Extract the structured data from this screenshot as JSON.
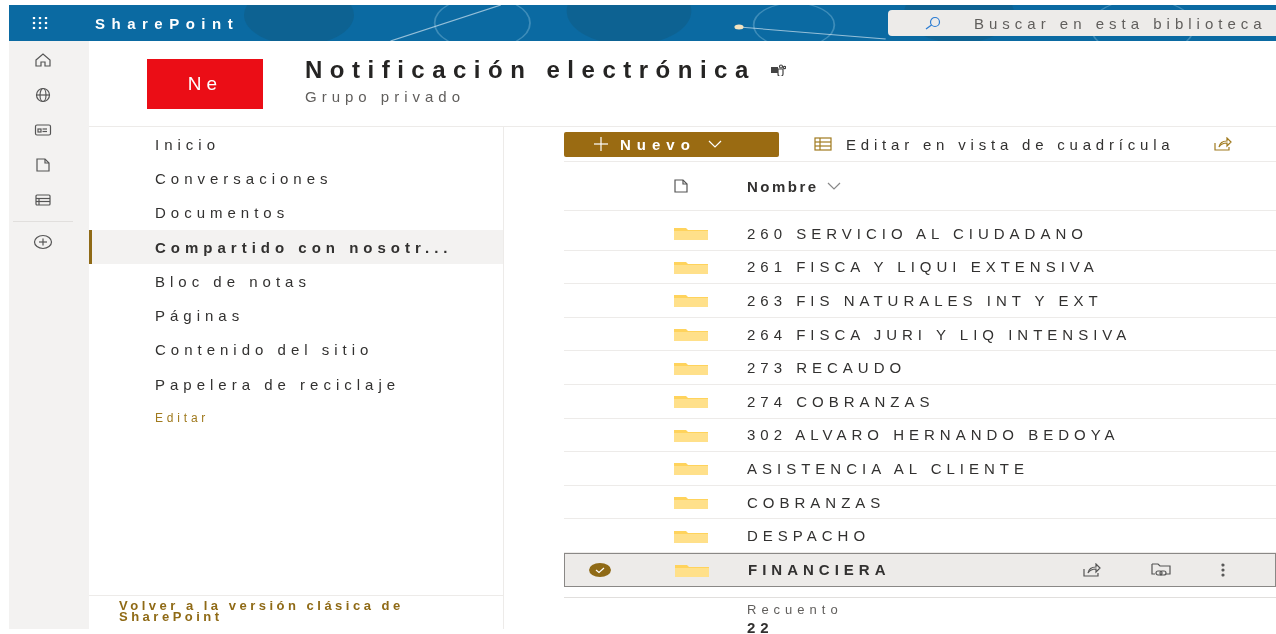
{
  "top_bar": {
    "app_name": "SharePoint",
    "search": {
      "placeholder": "Buscar en esta biblioteca"
    }
  },
  "site": {
    "logo_text": "Ne",
    "title": "Notificación electrónica",
    "subtitle": "Grupo privado"
  },
  "nav": {
    "items": [
      {
        "label": "Inicio",
        "selected": false
      },
      {
        "label": "Conversaciones",
        "selected": false
      },
      {
        "label": "Documentos",
        "selected": false
      },
      {
        "label": "Compartido con nosotr...",
        "selected": true
      },
      {
        "label": "Bloc de notas",
        "selected": false
      },
      {
        "label": "Páginas",
        "selected": false
      },
      {
        "label": "Contenido del sitio",
        "selected": false
      },
      {
        "label": "Papelera de reciclaje",
        "selected": false
      }
    ],
    "edit_link": "Editar",
    "classic_link": "Volver a la versión clásica de SharePoint"
  },
  "toolbar": {
    "new_button": "Nuevo",
    "grid_button": "Editar en vista de cuadrícula"
  },
  "table": {
    "columns": [
      "Nombre"
    ],
    "rows": [
      {
        "name": "260 SERVICIO AL CIUDADANO",
        "selected": false
      },
      {
        "name": "261 FISCA Y LIQUI EXTENSIVA",
        "selected": false
      },
      {
        "name": "263 FIS NATURALES INT Y EXT",
        "selected": false
      },
      {
        "name": "264 FISCA JURI Y LIQ INTENSIVA",
        "selected": false
      },
      {
        "name": "273 RECAUDO",
        "selected": false
      },
      {
        "name": "274 COBRANZAS",
        "selected": false
      },
      {
        "name": "302 ALVARO HERNANDO BEDOYA",
        "selected": false
      },
      {
        "name": "ASISTENCIA AL CLIENTE",
        "selected": false
      },
      {
        "name": "COBRANZAS",
        "selected": false
      },
      {
        "name": "DESPACHO",
        "selected": false
      },
      {
        "name": "FINANCIERA",
        "selected": true
      }
    ],
    "footer": {
      "label": "Recuento",
      "value": "22"
    }
  }
}
